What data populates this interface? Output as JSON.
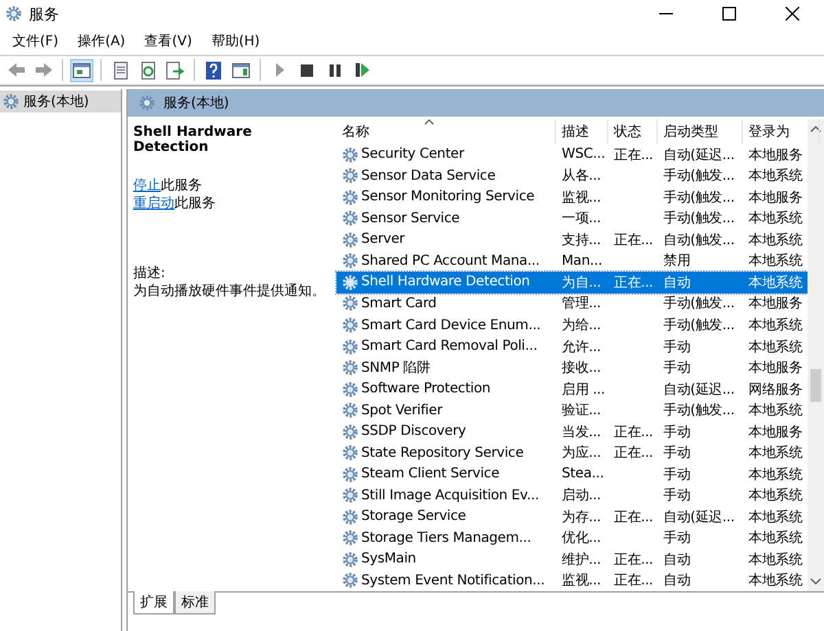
{
  "window": {
    "title": "服务"
  },
  "menu": [
    "文件(F)",
    "操作(A)",
    "查看(V)",
    "帮助(H)"
  ],
  "tree": [
    {
      "label": "服务(本地)",
      "selected": true
    }
  ],
  "pane_header": "服务(本地)",
  "details": {
    "title": "Shell Hardware Detection",
    "actions": [
      {
        "link": "停止",
        "text": "此服务"
      },
      {
        "link": "重启动",
        "text": "此服务"
      }
    ],
    "description_label": "描述:",
    "description": "为自动播放硬件事件提供通知。"
  },
  "table": {
    "columns": [
      "名称",
      "描述",
      "状态",
      "启动类型",
      "登录为"
    ],
    "rows": [
      {
        "cells": [
          "Security Center",
          "WSC...",
          "正在...",
          "自动(延迟...",
          "本地服务"
        ],
        "selected": false
      },
      {
        "cells": [
          "Sensor Data Service",
          "从各...",
          "",
          "手动(触发...",
          "本地系统"
        ],
        "selected": false
      },
      {
        "cells": [
          "Sensor Monitoring Service",
          "监视...",
          "",
          "手动(触发...",
          "本地服务"
        ],
        "selected": false
      },
      {
        "cells": [
          "Sensor Service",
          "一项...",
          "",
          "手动(触发...",
          "本地系统"
        ],
        "selected": false
      },
      {
        "cells": [
          "Server",
          "支持...",
          "正在...",
          "自动(触发...",
          "本地系统"
        ],
        "selected": false
      },
      {
        "cells": [
          "Shared PC Account Mana...",
          "Man...",
          "",
          "禁用",
          "本地系统"
        ],
        "selected": false
      },
      {
        "cells": [
          "Shell Hardware Detection",
          "为自...",
          "正在...",
          "自动",
          "本地系统"
        ],
        "selected": true
      },
      {
        "cells": [
          "Smart Card",
          "管理...",
          "",
          "手动(触发...",
          "本地服务"
        ],
        "selected": false
      },
      {
        "cells": [
          "Smart Card Device Enum...",
          "为给...",
          "",
          "手动(触发...",
          "本地系统"
        ],
        "selected": false
      },
      {
        "cells": [
          "Smart Card Removal Poli...",
          "允许...",
          "",
          "手动",
          "本地系统"
        ],
        "selected": false
      },
      {
        "cells": [
          "SNMP 陷阱",
          "接收...",
          "",
          "手动",
          "本地服务"
        ],
        "selected": false
      },
      {
        "cells": [
          "Software Protection",
          "启用 ...",
          "",
          "自动(延迟...",
          "网络服务"
        ],
        "selected": false
      },
      {
        "cells": [
          "Spot Verifier",
          "验证...",
          "",
          "手动(触发...",
          "本地系统"
        ],
        "selected": false
      },
      {
        "cells": [
          "SSDP Discovery",
          "当发...",
          "正在...",
          "手动",
          "本地服务"
        ],
        "selected": false
      },
      {
        "cells": [
          "State Repository Service",
          "为应...",
          "正在...",
          "手动",
          "本地系统"
        ],
        "selected": false
      },
      {
        "cells": [
          "Steam Client Service",
          "Stea...",
          "",
          "手动",
          "本地系统"
        ],
        "selected": false
      },
      {
        "cells": [
          "Still Image Acquisition Ev...",
          "启动...",
          "",
          "手动",
          "本地系统"
        ],
        "selected": false
      },
      {
        "cells": [
          "Storage Service",
          "为存...",
          "正在...",
          "自动(延迟...",
          "本地系统"
        ],
        "selected": false
      },
      {
        "cells": [
          "Storage Tiers Managem...",
          "优化...",
          "",
          "手动",
          "本地系统"
        ],
        "selected": false
      },
      {
        "cells": [
          "SysMain",
          "维护...",
          "正在...",
          "自动",
          "本地系统"
        ],
        "selected": false
      },
      {
        "cells": [
          "System Event Notification...",
          "监视...",
          "正在...",
          "自动",
          "本地系统"
        ],
        "selected": false
      }
    ]
  },
  "tabs": [
    {
      "label": "扩展",
      "selected": true
    },
    {
      "label": "标准",
      "selected": false
    }
  ]
}
